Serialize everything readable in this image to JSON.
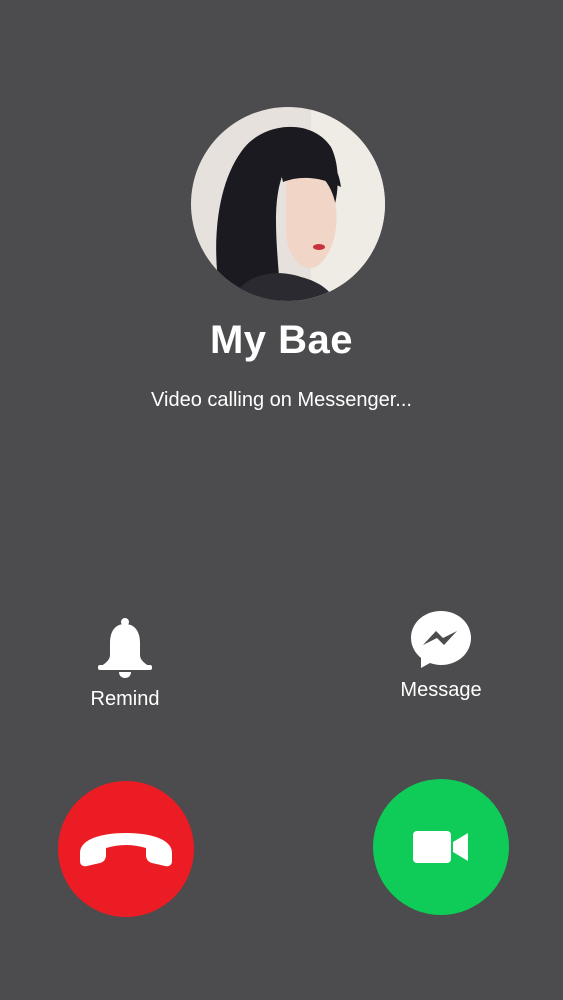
{
  "caller": {
    "name": "My Bae",
    "status": "Video calling on Messenger..."
  },
  "actions": {
    "remind_label": "Remind",
    "message_label": "Message"
  },
  "buttons": {
    "decline": {
      "icon": "phone-hangup-icon",
      "color": "#ec1c24"
    },
    "accept": {
      "icon": "video-camera-icon",
      "color": "#0fcb58"
    }
  },
  "colors": {
    "background": "#4c4b4d",
    "text": "#ffffff"
  }
}
